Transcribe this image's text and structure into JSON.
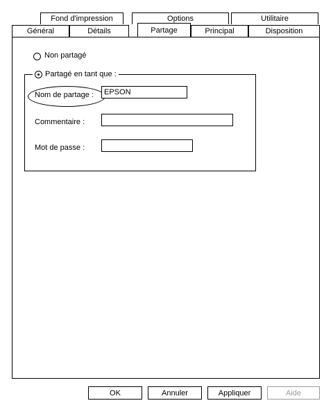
{
  "tabs_back": [
    "Fond d'impression",
    "Options",
    "Utilitaire"
  ],
  "tabs_front": [
    "Général",
    "Détails",
    "Partage",
    "Principal",
    "Disposition"
  ],
  "active_tab": "Partage",
  "sharing": {
    "not_shared_label": "Non partagé",
    "shared_as_label": "Partagé en tant que :",
    "selected": "shared",
    "share_name_label": "Nom de partage :",
    "share_name_value": "EPSON",
    "comment_label": "Commentaire :",
    "comment_value": "",
    "password_label": "Mot de passe :",
    "password_value": ""
  },
  "buttons": {
    "ok": "OK",
    "cancel": "Annuler",
    "apply": "Appliquer",
    "help": "Aide"
  }
}
